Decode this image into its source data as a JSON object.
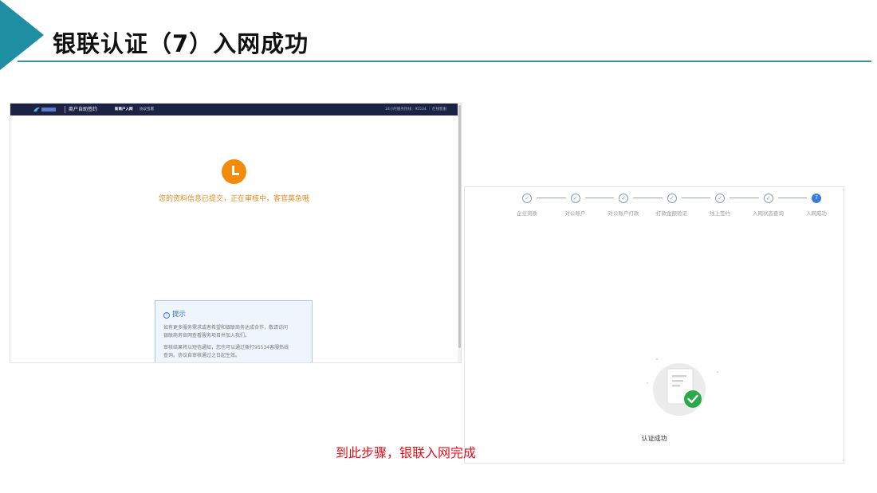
{
  "slide": {
    "title": "银联认证（7）入网成功",
    "caption": "到此步骤，银联入网完成"
  },
  "left_screen": {
    "nav": {
      "brand": "商户自助签约",
      "items": [
        "新商户入网",
        "协议签署"
      ],
      "right_text": "24小时服务热线：95534 ｜ 在线客服"
    },
    "pending_message": "您的资料信息已提交，正在审核中，客官莫急哦",
    "tip": {
      "title": "提示",
      "lines": [
        "如有更多服务需求或者希望和银联商务达成合作，敬请访问",
        "银联商务官网查看服务项目并加入我们。",
        "审核结果将以短信通知，您也可以通过拨打95534客服热线",
        "查询。协议自审核通过之日起生效。"
      ]
    },
    "colors": {
      "nav_bg": "#1b2244",
      "clock": "#f28b0c",
      "pending_text": "#e48a1f"
    }
  },
  "right_screen": {
    "steps": [
      {
        "label": "企业资质",
        "state": "done",
        "mark": "✓"
      },
      {
        "label": "对公账户",
        "state": "done",
        "mark": "✓"
      },
      {
        "label": "对公账户打款",
        "state": "done",
        "mark": "✓"
      },
      {
        "label": "打款金额验证",
        "state": "done",
        "mark": "✓"
      },
      {
        "label": "线上签约",
        "state": "done",
        "mark": "✓"
      },
      {
        "label": "入网状态查询",
        "state": "done",
        "mark": "✓"
      },
      {
        "label": "入网成功",
        "state": "active",
        "mark": "7"
      }
    ],
    "success_message": "认证成功",
    "colors": {
      "active_step": "#3a7be0",
      "check": "#2aa84a"
    }
  }
}
